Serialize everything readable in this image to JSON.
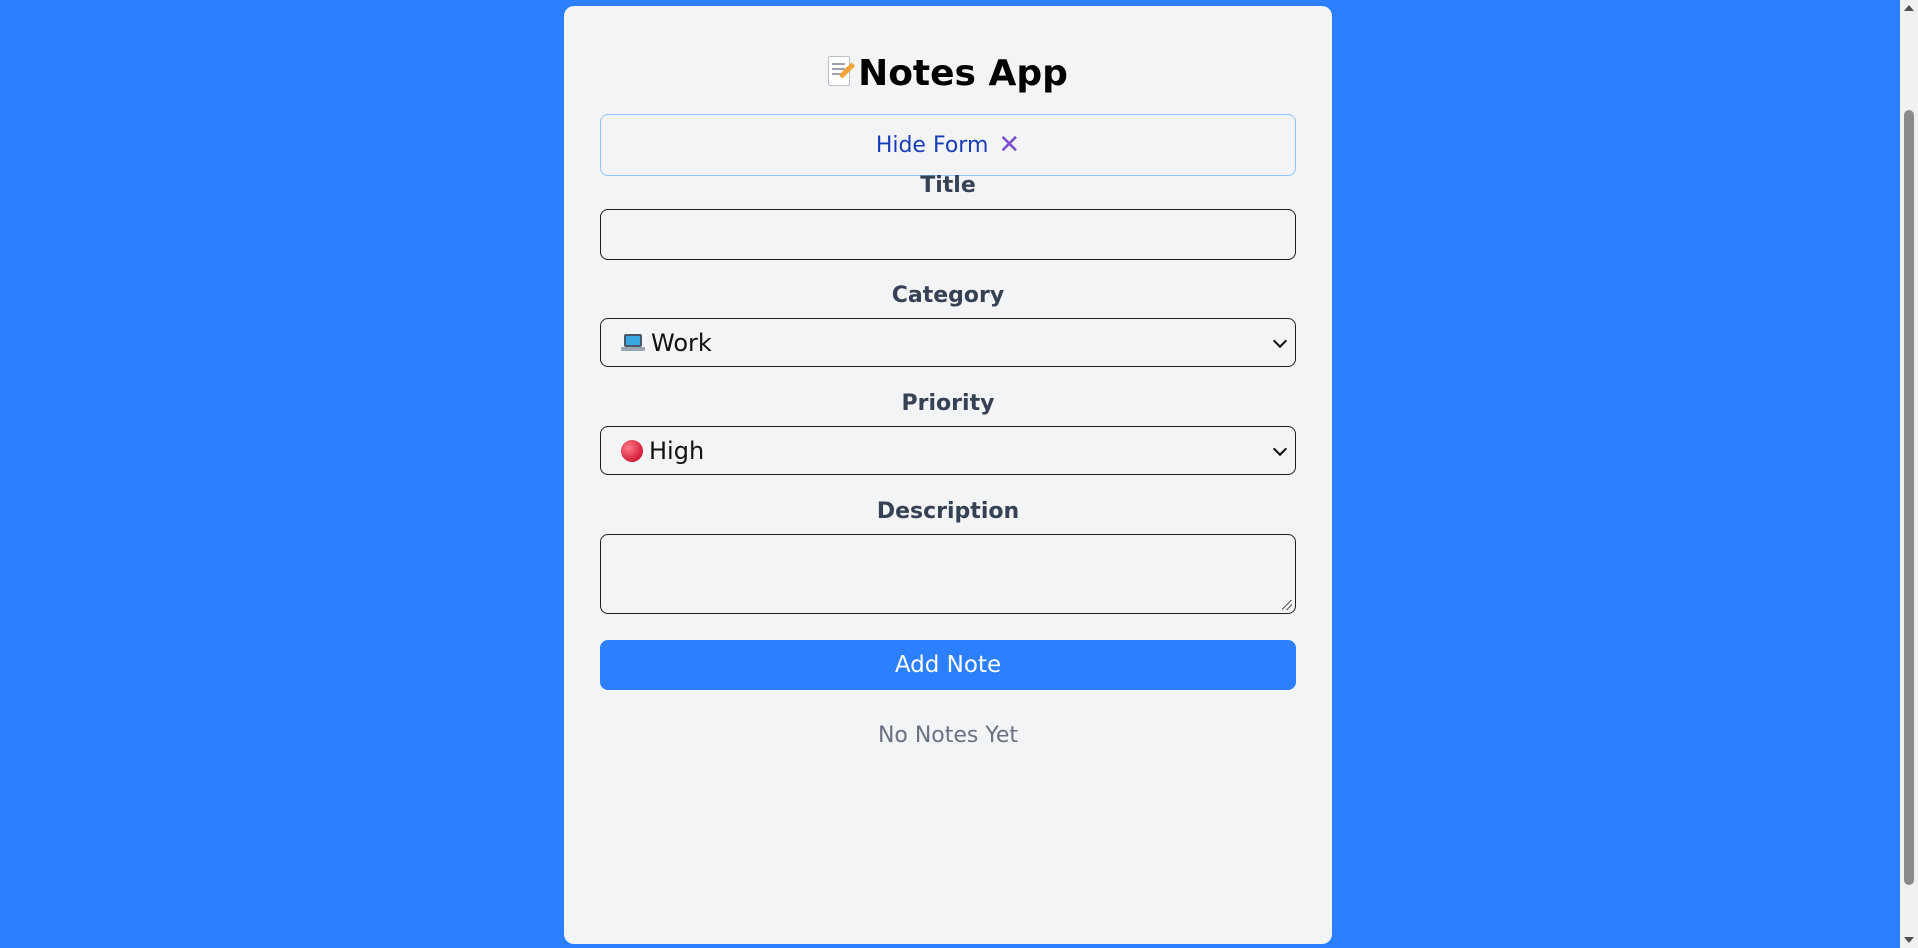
{
  "app": {
    "title": "Notes App",
    "title_icon": "memo-icon"
  },
  "toggle": {
    "label": "Hide Form",
    "icon": "cross-mark-icon",
    "icon_glyph": "✕"
  },
  "form": {
    "title_label": "Title",
    "title_value": "",
    "category_label": "Category",
    "category_value": "Work",
    "category_icon": "laptop-icon",
    "priority_label": "Priority",
    "priority_value": "High",
    "priority_icon": "red-circle-icon",
    "description_label": "Description",
    "description_value": "",
    "submit_label": "Add Note"
  },
  "notes": {
    "empty_message": "No Notes Yet"
  },
  "colors": {
    "background": "#2c7fff",
    "card": "#f3f4f6",
    "button": "#2c7fff",
    "toggle_text": "#193cb8",
    "toggle_border": "#8ec5ff"
  }
}
